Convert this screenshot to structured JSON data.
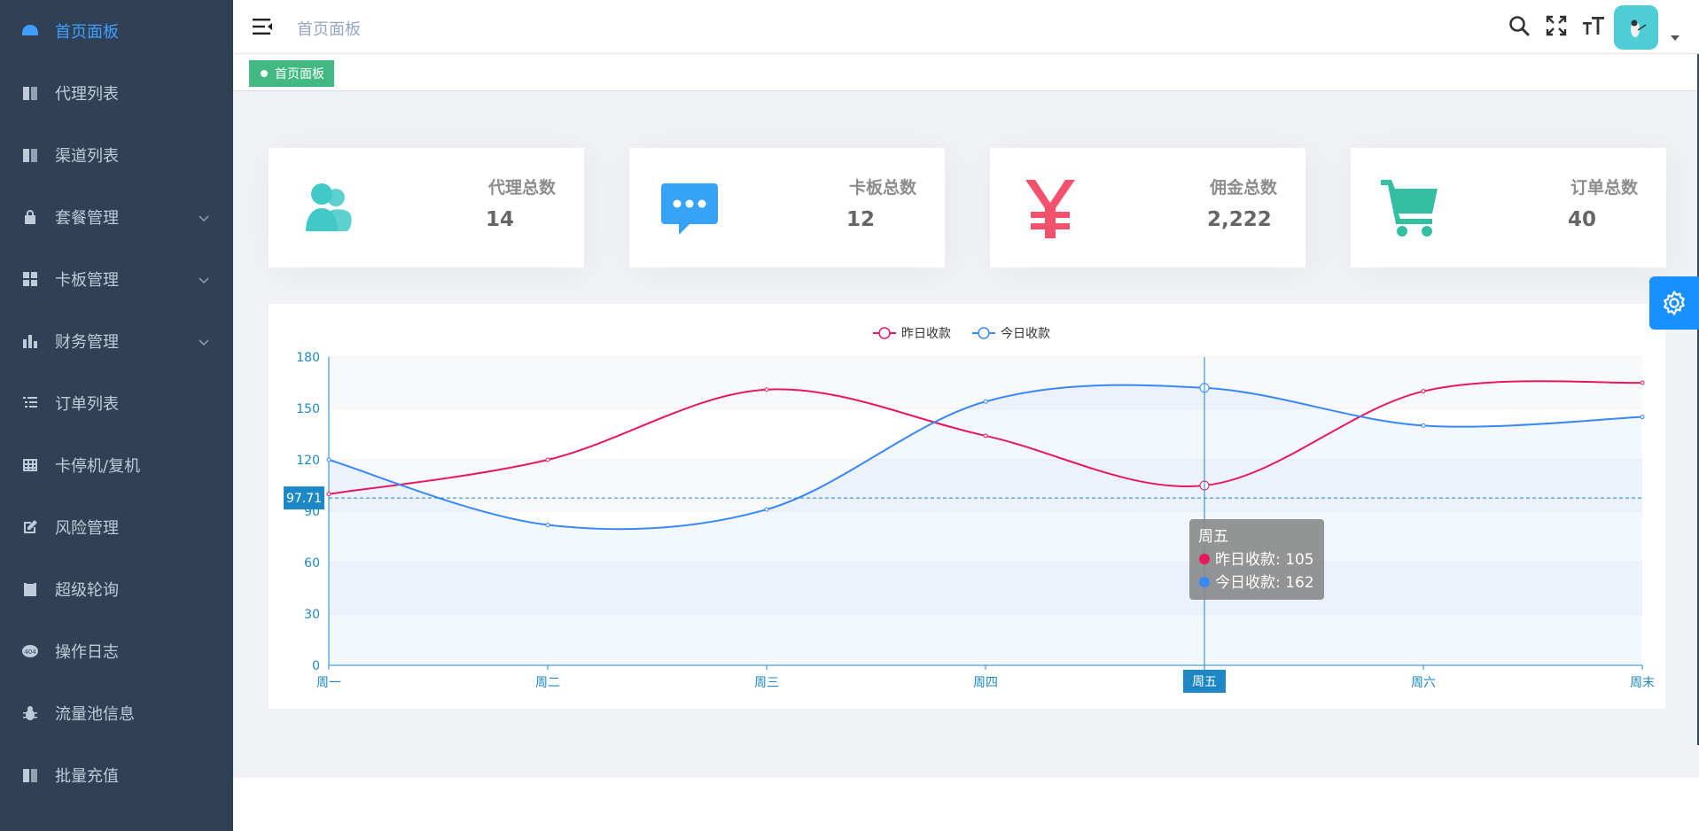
{
  "sidebar": {
    "items": [
      {
        "label": "首页面板",
        "icon": "dashboard-icon",
        "active": true,
        "has_arrow": false
      },
      {
        "label": "代理列表",
        "icon": "book-icon",
        "active": false,
        "has_arrow": false
      },
      {
        "label": "渠道列表",
        "icon": "book-icon",
        "active": false,
        "has_arrow": false
      },
      {
        "label": "套餐管理",
        "icon": "lock-icon",
        "active": false,
        "has_arrow": true
      },
      {
        "label": "卡板管理",
        "icon": "grid-icon",
        "active": false,
        "has_arrow": true
      },
      {
        "label": "财务管理",
        "icon": "bar-chart-icon",
        "active": false,
        "has_arrow": true
      },
      {
        "label": "订单列表",
        "icon": "list-icon",
        "active": false,
        "has_arrow": false
      },
      {
        "label": "卡停机/复机",
        "icon": "table-icon",
        "active": false,
        "has_arrow": false
      },
      {
        "label": "风险管理",
        "icon": "edit-icon",
        "active": false,
        "has_arrow": false
      },
      {
        "label": "超级轮询",
        "icon": "clipboard-icon",
        "active": false,
        "has_arrow": false
      },
      {
        "label": "操作日志",
        "icon": "404-icon",
        "active": false,
        "has_arrow": false
      },
      {
        "label": "流量池信息",
        "icon": "bug-icon",
        "active": false,
        "has_arrow": false
      },
      {
        "label": "批量充值",
        "icon": "book-icon",
        "active": false,
        "has_arrow": false
      }
    ]
  },
  "navbar": {
    "breadcrumb": "首页面板",
    "icons": [
      "search-icon",
      "fullscreen-icon",
      "font-size-icon"
    ]
  },
  "tags": [
    {
      "label": "首页面板"
    }
  ],
  "cards": [
    {
      "label": "代理总数",
      "value": "14",
      "icon": "peoples-icon",
      "color": "#40c9c6"
    },
    {
      "label": "卡板总数",
      "value": "12",
      "icon": "message-icon",
      "color": "#36a3f7"
    },
    {
      "label": "佣金总数",
      "value": "2,222",
      "icon": "money-icon",
      "color": "#f4516c"
    },
    {
      "label": "订单总数",
      "value": "40",
      "icon": "shopping-icon",
      "color": "#34bfa3"
    }
  ],
  "chart_data": {
    "type": "line",
    "categories": [
      "周一",
      "周二",
      "周三",
      "周四",
      "周五",
      "周六",
      "周末"
    ],
    "series": [
      {
        "name": "昨日收款",
        "values": [
          100,
          120,
          161,
          134,
          105,
          160,
          165
        ],
        "color": "#e6185e"
      },
      {
        "name": "今日收款",
        "values": [
          120,
          82,
          91,
          154,
          162,
          140,
          145
        ],
        "color": "#3888fa"
      }
    ],
    "ylim": [
      0,
      180
    ],
    "yticks": [
      0,
      30,
      60,
      90,
      120,
      150,
      180
    ],
    "legend_position": "top-center",
    "crosshair": {
      "category_index": 4,
      "y_value": 97.71,
      "y_label": "97.71",
      "x_label": "周五"
    },
    "tooltip": {
      "title": "周五",
      "rows": [
        {
          "text": "昨日收款: 105",
          "color": "#e6185e"
        },
        {
          "text": "今日收款: 162",
          "color": "#3888fa"
        }
      ]
    }
  }
}
